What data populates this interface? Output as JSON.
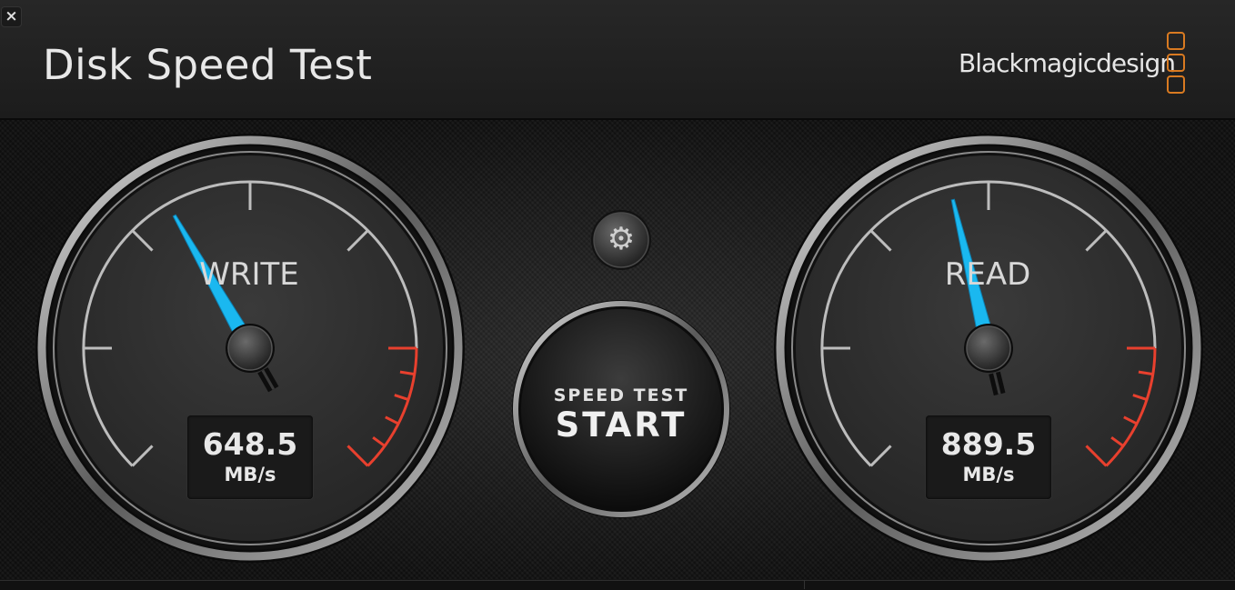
{
  "window": {
    "close_glyph": "×"
  },
  "header": {
    "title": "Disk Speed Test",
    "brand": "Blackmagicdesign"
  },
  "colors": {
    "needle": "#1ab8f0",
    "redline": "#e8402e",
    "logo": "#d97a21"
  },
  "gauges": [
    {
      "label": "WRITE",
      "value": "648.5",
      "unit": "MB/s",
      "needle_level": 0.39
    },
    {
      "label": "READ",
      "value": "889.5",
      "unit": "MB/s",
      "needle_level": 0.45
    }
  ],
  "controls": {
    "start_top": "SPEED TEST",
    "start_main": "START",
    "settings_icon": "gear-icon"
  }
}
